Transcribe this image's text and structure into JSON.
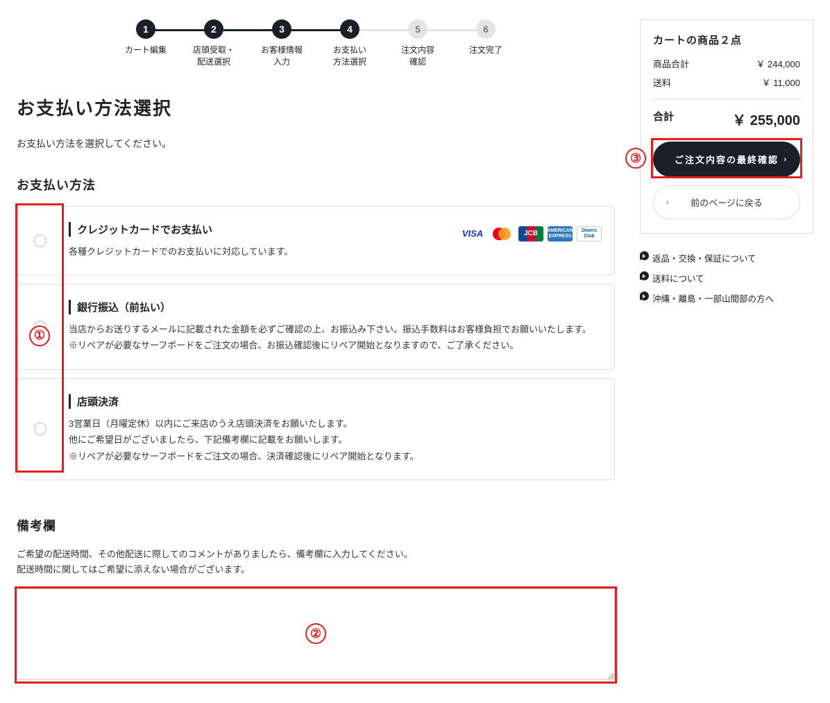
{
  "stepper": [
    {
      "num": "1",
      "label": "カート編集"
    },
    {
      "num": "2",
      "label": "店頭受取・\n配送選択"
    },
    {
      "num": "3",
      "label": "お客様情報\n入力"
    },
    {
      "num": "4",
      "label": "お支払い\n方法選択"
    },
    {
      "num": "5",
      "label": "注文内容\n確認"
    },
    {
      "num": "6",
      "label": "注文完了"
    }
  ],
  "page": {
    "title": "お支払い方法選択",
    "subtitle": "お支払い方法を選択してください。"
  },
  "payment": {
    "heading": "お支払い方法",
    "items": [
      {
        "title": "クレジットカードでお支払い",
        "desc": "各種クレジットカードでのお支払いに対応しています。"
      },
      {
        "title": "銀行振込（前払い）",
        "desc": "当店からお送りするメールに記載された金額を必ずご確認の上、お振込み下さい。振込手数料はお客様負担でお願いいたします。\n※リペアが必要なサーフボードをご注文の場合、お振込確認後にリペア開始となりますので、ご了承ください。"
      },
      {
        "title": "店頭決済",
        "desc": "3営業日（月曜定休）以内にご来店のうえ店頭決済をお願いたします。\n他にご希望日がございましたら、下記備考欄に記載をお願いします。\n※リペアが必要なサーフボードをご注文の場合、決済確認後にリペア開始となります。"
      }
    ]
  },
  "card_brands": [
    "VISA",
    "mastercard",
    "JCB",
    "AMERICAN EXPRESS",
    "Diners Club"
  ],
  "remarks": {
    "heading": "備考欄",
    "desc": "ご希望の配送時間、その他配送に際してのコメントがありましたら、備考欄に入力してください。\n配送時間に関してはご希望に添えない場合がございます。",
    "value": ""
  },
  "summary": {
    "title": "カートの商品２点",
    "subtotal_label": "商品合計",
    "subtotal_value": "￥ 244,000",
    "shipping_label": "送料",
    "shipping_value": "￥ 11,000",
    "total_label": "合計",
    "total_value": "￥ 255,000"
  },
  "buttons": {
    "confirm": "ご注文内容の最終確認",
    "back": "前のページに戻る"
  },
  "links": [
    "返品・交換・保証について",
    "送料について",
    "沖縄・離島・一部山間部の方へ"
  ],
  "callouts": [
    "①",
    "②",
    "③"
  ]
}
